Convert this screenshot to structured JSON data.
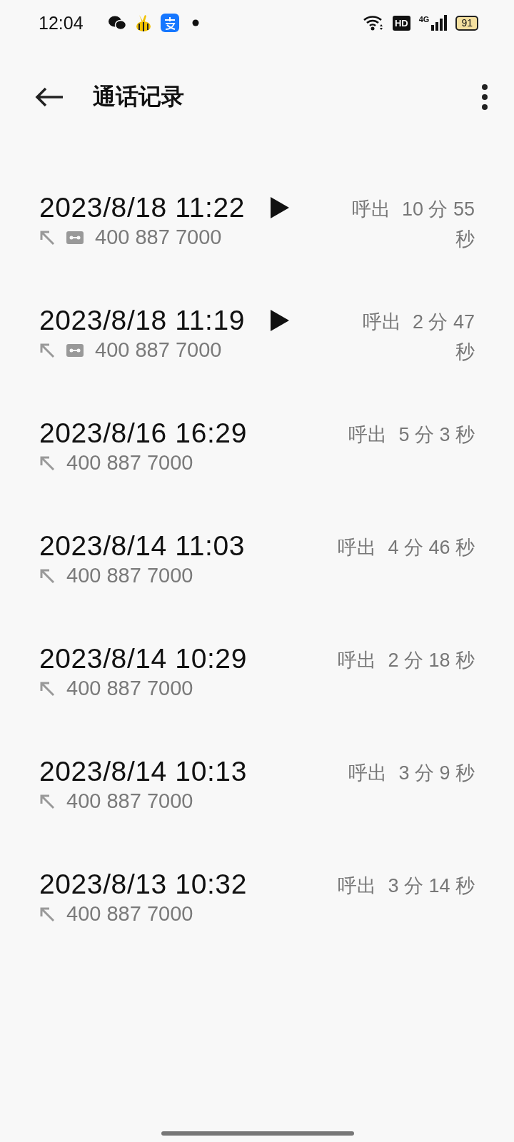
{
  "status_bar": {
    "time": "12:04",
    "hd": "HD",
    "network": "4G",
    "battery": "91"
  },
  "header": {
    "title": "通话记录"
  },
  "calls": [
    {
      "datetime": "2023/8/18 11:22",
      "number": "400 887 7000",
      "recorded": true,
      "direction": "呼出",
      "duration": "10 分 55 秒"
    },
    {
      "datetime": "2023/8/18 11:19",
      "number": "400 887 7000",
      "recorded": true,
      "direction": "呼出",
      "duration": "2 分 47 秒"
    },
    {
      "datetime": "2023/8/16 16:29",
      "number": "400 887 7000",
      "recorded": false,
      "direction": "呼出",
      "duration": "5 分 3 秒"
    },
    {
      "datetime": "2023/8/14 11:03",
      "number": "400 887 7000",
      "recorded": false,
      "direction": "呼出",
      "duration": "4 分 46 秒"
    },
    {
      "datetime": "2023/8/14 10:29",
      "number": "400 887 7000",
      "recorded": false,
      "direction": "呼出",
      "duration": "2 分 18 秒"
    },
    {
      "datetime": "2023/8/14 10:13",
      "number": "400 887 7000",
      "recorded": false,
      "direction": "呼出",
      "duration": "3 分 9 秒"
    },
    {
      "datetime": "2023/8/13 10:32",
      "number": "400 887 7000",
      "recorded": false,
      "direction": "呼出",
      "duration": "3 分 14 秒"
    }
  ]
}
